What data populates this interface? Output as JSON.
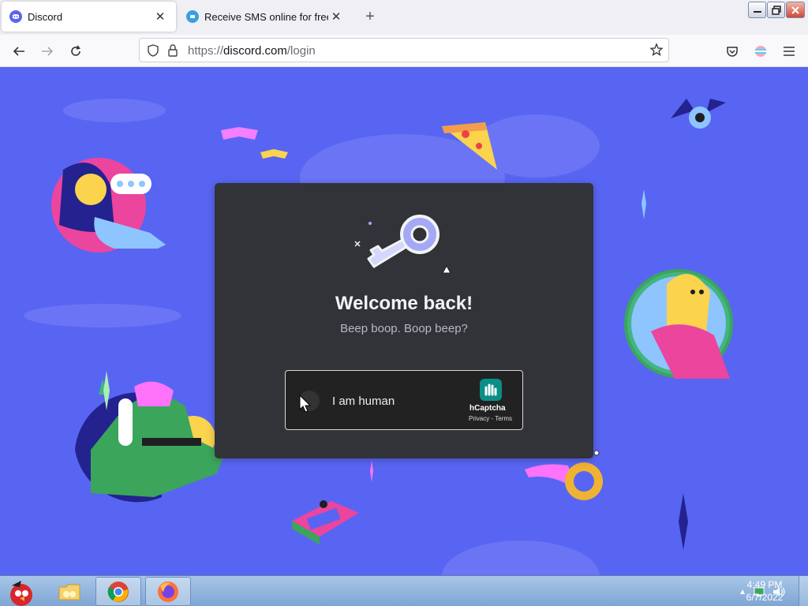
{
  "tabs": [
    {
      "label": "Discord",
      "favicon": "discord-icon",
      "color": "#5865f2"
    },
    {
      "label": "Receive SMS online for free |",
      "favicon": "sms-site-icon",
      "color": "#3b9fe0"
    }
  ],
  "window_controls": {
    "minimize": "minimize-icon",
    "restore": "restore-icon",
    "close": "close-icon"
  },
  "navbar": {
    "url_scheme": "https://",
    "url_host": "discord.com",
    "url_path": "/login"
  },
  "login": {
    "heading": "Welcome back!",
    "subheading": "Beep boop. Boop beep?",
    "captcha": {
      "label": "I am human",
      "brand": "hCaptcha",
      "privacy": "Privacy",
      "separator": " - ",
      "terms": "Terms"
    }
  },
  "taskbar": {
    "apps": [
      "angry-birds-start-icon",
      "folder-icon",
      "chrome-icon",
      "firefox-icon"
    ],
    "time": "4:49 PM",
    "date": "6/7/2022"
  },
  "colors": {
    "discord_blurple": "#5865f2",
    "card_bg": "#313338",
    "heading": "#f2f3f5",
    "subtext": "#b5bac1"
  }
}
